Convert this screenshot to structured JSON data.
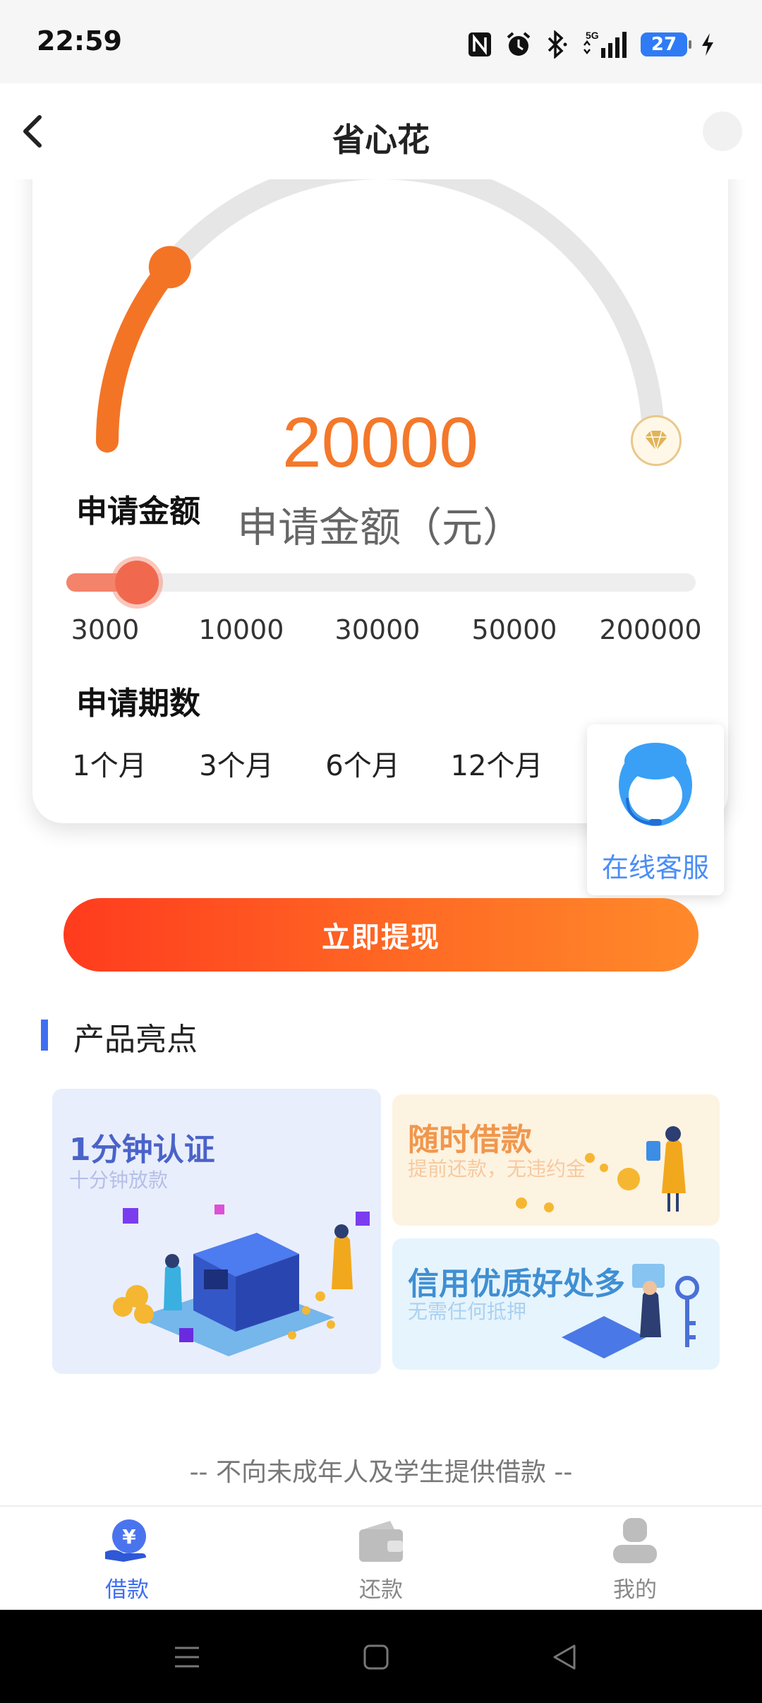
{
  "status_bar": {
    "time": "22:59",
    "network": "5G",
    "battery": "27",
    "icons": [
      "nfc-icon",
      "alarm-icon",
      "bluetooth-icon",
      "signal-icon",
      "battery-icon",
      "charging-icon"
    ]
  },
  "header": {
    "title": "省心花",
    "back_icon": "back-arrow-icon"
  },
  "loan": {
    "amount": "20000",
    "amount_caption": "申请金额（元）",
    "gauge_progress": 0.22,
    "amount_label": "申请金额",
    "amount_options": [
      "3000",
      "10000",
      "30000",
      "50000",
      "200000"
    ],
    "slider_value": 0.09,
    "term_label": "申请期数",
    "term_options": [
      "1个月",
      "3个月",
      "6个月",
      "12个月"
    ],
    "accent_color": "#f4782a",
    "gauge_end_icon": "diamond-icon"
  },
  "customer_service": {
    "label": "在线客服",
    "icon": "agent-headset-icon"
  },
  "cta": {
    "label": "立即提现"
  },
  "highlights": {
    "title": "产品亮点",
    "items": [
      {
        "title": "1分钟认证",
        "subtitle": "十分钟放款"
      },
      {
        "title": "随时借款",
        "subtitle": "提前还款，无违约金"
      },
      {
        "title": "信用优质好处多",
        "subtitle": "无需任何抵押"
      }
    ]
  },
  "disclaimer": "-- 不向未成年人及学生提供借款 --",
  "tabbar": {
    "items": [
      {
        "label": "借款",
        "icon": "loan-yen-icon",
        "active": true
      },
      {
        "label": "还款",
        "icon": "wallet-icon",
        "active": false
      },
      {
        "label": "我的",
        "icon": "profile-icon",
        "active": false
      }
    ],
    "active_color": "#3f6ef0",
    "inactive_color": "#888888"
  },
  "system_nav": {
    "icons": [
      "menu-icon",
      "home-icon",
      "back-icon"
    ]
  }
}
